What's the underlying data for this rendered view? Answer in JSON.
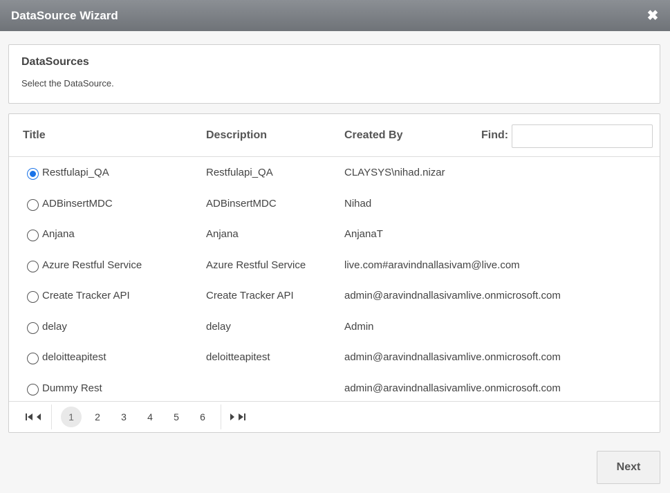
{
  "window": {
    "title": "DataSource Wizard",
    "close_icon": "close-icon"
  },
  "info": {
    "heading": "DataSources",
    "subtitle": "Select the DataSource."
  },
  "grid": {
    "columns": {
      "title": "Title",
      "description": "Description",
      "created_by": "Created By",
      "find_label": "Find:"
    },
    "find": {
      "value": "",
      "placeholder": ""
    },
    "rows": [
      {
        "title": "Restfulapi_QA",
        "description": "Restfulapi_QA",
        "created_by": "CLAYSYS\\nihad.nizar",
        "selected": true
      },
      {
        "title": "ADBinsertMDC",
        "description": "ADBinsertMDC",
        "created_by": "Nihad",
        "selected": false
      },
      {
        "title": "Anjana",
        "description": "Anjana",
        "created_by": "AnjanaT",
        "selected": false
      },
      {
        "title": "Azure Restful Service",
        "description": "Azure Restful Service",
        "created_by": "live.com#aravindnallasivam@live.com",
        "selected": false
      },
      {
        "title": "Create Tracker API",
        "description": "Create Tracker API",
        "created_by": "admin@aravindnallasivamlive.onmicrosoft.com",
        "selected": false
      },
      {
        "title": "delay",
        "description": "delay",
        "created_by": "Admin",
        "selected": false
      },
      {
        "title": "deloitteapitest",
        "description": "deloitteapitest",
        "created_by": "admin@aravindnallasivamlive.onmicrosoft.com",
        "selected": false
      },
      {
        "title": "Dummy Rest",
        "description": "",
        "created_by": "admin@aravindnallasivamlive.onmicrosoft.com",
        "selected": false
      }
    ],
    "pager": {
      "pages": [
        "1",
        "2",
        "3",
        "4",
        "5",
        "6"
      ],
      "current_page": "1"
    }
  },
  "footer": {
    "next_label": "Next"
  },
  "colors": {
    "titlebar": "#7d8186",
    "accent": "#1a73e8"
  }
}
